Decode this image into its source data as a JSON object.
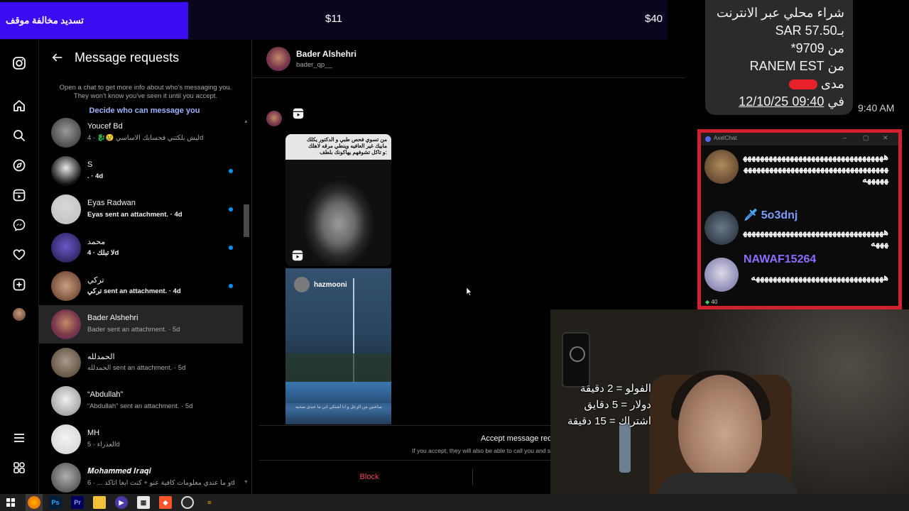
{
  "banner": {
    "left_text": "تسديد مخالفة موقف",
    "mid_price": "$11",
    "right_price": "$40"
  },
  "panel": {
    "title": "Message requests",
    "description": "Open a chat to get more info about who's messaging you. They won't know you've seen it until you accept.",
    "decide_link": "Decide who can message you",
    "rows": [
      {
        "name": "Youcef Bd",
        "preview": "ليش بلكتني فحسابك الاساسي 😢🐉 · 4d",
        "unread": false
      },
      {
        "name": "S",
        "preview": ". · 4d",
        "unread": true
      },
      {
        "name": "Eyas Radwan",
        "preview": "Eyas sent an attachment. · 4d",
        "unread": true
      },
      {
        "name": "محمد",
        "preview": "لا تبلك · 4d",
        "unread": true
      },
      {
        "name": "تركي",
        "preview": "تركي sent an attachment. · 4d",
        "unread": true
      },
      {
        "name": "Bader Alshehri",
        "preview": "Bader sent an attachment. · 5d",
        "unread": false
      },
      {
        "name": "الحمدلله",
        "preview": "الحمدلله sent an attachment. · 5d",
        "unread": false
      },
      {
        "name": "“Abdullah”",
        "preview": "“Abdullah” sent an attachment. · 5d",
        "unread": false
      },
      {
        "name": "MH",
        "preview": "العذراء · 5d",
        "unread": false
      },
      {
        "name": "𝑴𝒐𝒉𝒂𝒎𝒎𝒆𝒅 𝑰𝒓𝒂𝒒𝒊",
        "preview": "و ما عندي معلومات كافية عنو + كنت ابغا اتاكد ... · 6d",
        "unread": false
      }
    ]
  },
  "chat": {
    "name": "Bader Alshehri",
    "username": "bader_qp__",
    "card1_caption": "من تسوي فحص طبي و الدكتور يكلك مابيك غير العافيه وينطي مرقه لاهلك و تاكل تشوفهم يهاكونك بلطف:",
    "card2_user": "hazmooni",
    "card2_caption": "ساعتين من الزعل و انا أشتكي اني ما عندي صحبه",
    "accept_title": "Accept message request",
    "accept_desc": "If you accept, they will also be able to call you and see info such as your activity status and when you've read messages.",
    "block_label": "Block"
  },
  "receipt": {
    "lines": [
      "شراء محلي عبر الانترنت",
      "بـSAR 57.50",
      "من 9709*",
      "من RANEM EST",
      "مدى"
    ],
    "date_line_prefix": "في",
    "date_line_value": "12/10/25 09:40",
    "time": "9:40 AM"
  },
  "axelchat": {
    "title": "AxelChat",
    "messages": [
      {
        "user": "",
        "text": "هههههههههههههههههههههههههههههههههههههههههههههههههههههههههههههههههههههههههه"
      },
      {
        "user": "5o3dnj",
        "text": "هههههههههههههههههههههههههههههههههههههه"
      },
      {
        "user": "NAWAF15264",
        "text": "هههههههههههههههههههههههههههههههه"
      }
    ],
    "viewer_count": "40"
  },
  "webcam": {
    "overlay_lines": [
      "الفولو = 2 دقيقة",
      "دولار = 5 دقايق",
      "اشتراك = 15 دقيقة"
    ]
  },
  "taskbar": {
    "apps": [
      "start",
      "firefox",
      "Ps",
      "Pr",
      "files",
      "player",
      "store",
      "brave",
      "obs",
      "app"
    ]
  },
  "colors": {
    "accent_blue": "#0095f6",
    "block_red": "#ed4956",
    "banner_purple": "#3b0cf2",
    "axel_border": "#d1202e"
  }
}
